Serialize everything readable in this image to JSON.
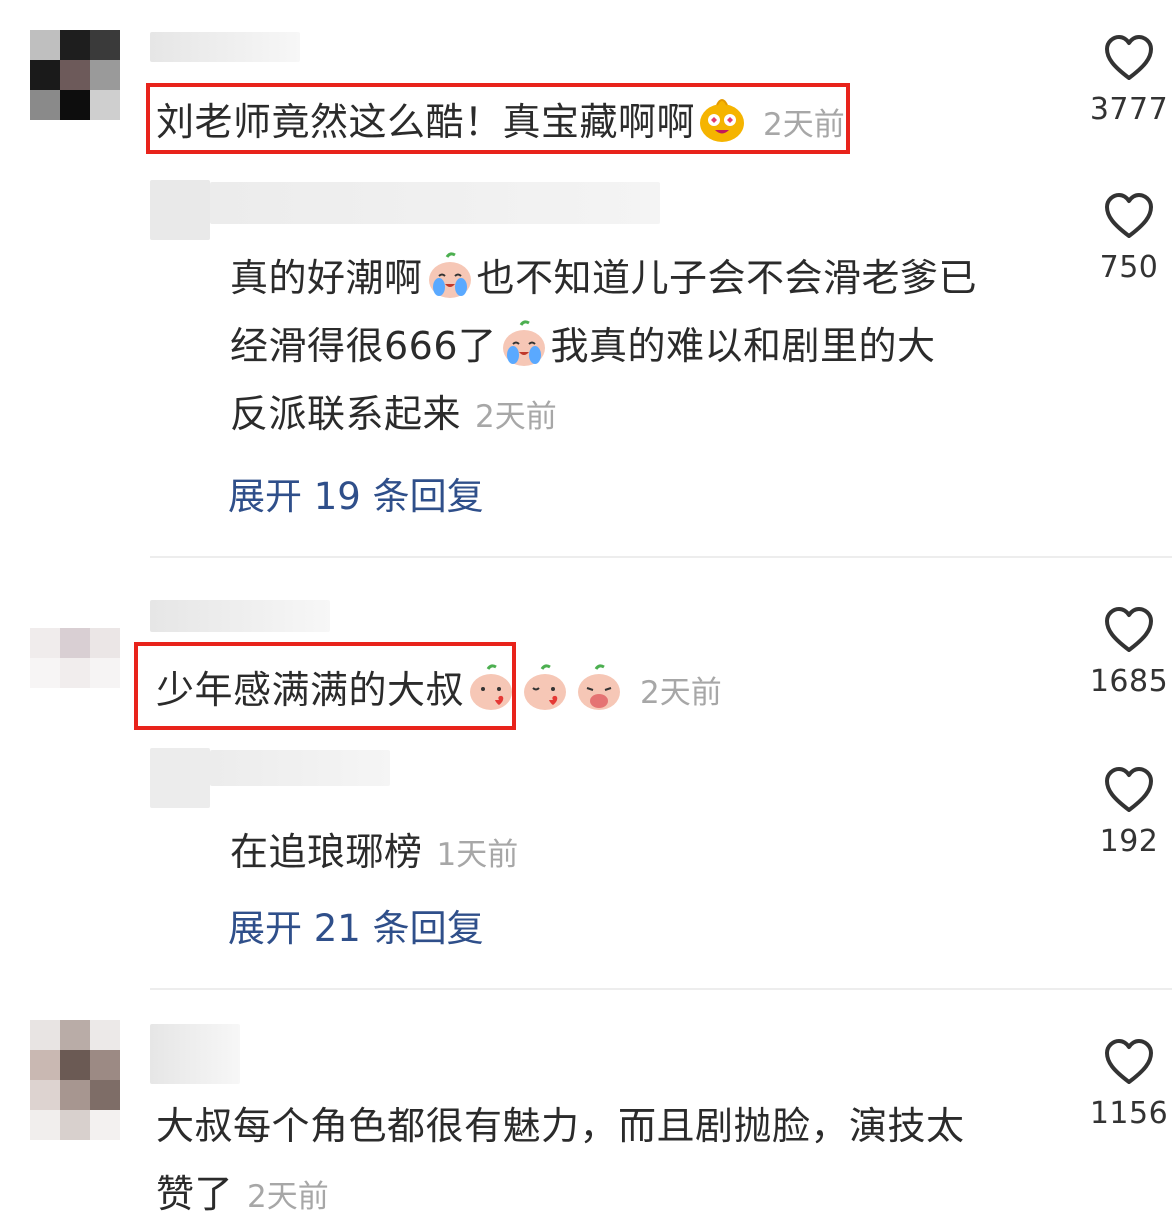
{
  "comments": [
    {
      "text": "刘老师竟然这么酷！真宝藏啊啊",
      "time": "2天前",
      "likes": "3777",
      "emoji": "heart-eyes-emoji",
      "reply": {
        "text_line1": "真的好潮啊",
        "text_line1b": "也不知道儿子会不会滑老爹已",
        "text_line2": "经滑得很666了",
        "text_line2b": "我真的难以和剧里的大",
        "text_line3": "反派联系起来",
        "time": "2天前",
        "likes": "750",
        "expand_label": "展开 19 条回复"
      }
    },
    {
      "text": "少年感满满的大叔",
      "time": "2天前",
      "likes": "1685",
      "reply": {
        "text": "在追琅琊榜",
        "time": "1天前",
        "likes": "192",
        "expand_label": "展开 21 条回复"
      }
    },
    {
      "text_line1": "大叔每个角色都很有魅力，而且剧抛脸，演技太",
      "text_line2": "赞了",
      "time": "2天前",
      "likes": "1156"
    }
  ],
  "colors": {
    "highlight_box": "#e8231b",
    "link": "#2f4f8a",
    "timestamp": "#a7a7a7"
  }
}
